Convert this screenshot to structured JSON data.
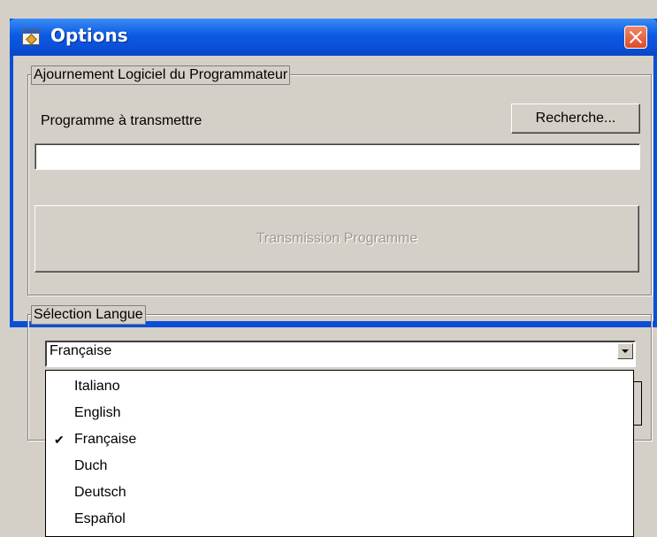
{
  "window": {
    "title": "Options"
  },
  "update_group": {
    "legend": "Ajournement Logiciel du Programmateur",
    "program_label": "Programme à transmettre",
    "browse_button": "Recherche...",
    "program_path": "",
    "transmit_button": "Transmission Programme"
  },
  "language_group": {
    "legend": "Sélection Langue",
    "selected": "Française",
    "options": [
      {
        "label": "Italiano",
        "checked": false
      },
      {
        "label": "English",
        "checked": false
      },
      {
        "label": "Française",
        "checked": true
      },
      {
        "label": "Duch",
        "checked": false
      },
      {
        "label": "Deutsch",
        "checked": false
      },
      {
        "label": "Español",
        "checked": false
      }
    ],
    "check_mark": "✔"
  },
  "colors": {
    "titlebar": "#0a4fd6",
    "window_bg": "#d4d0c8",
    "close_button": "#e04c25"
  }
}
